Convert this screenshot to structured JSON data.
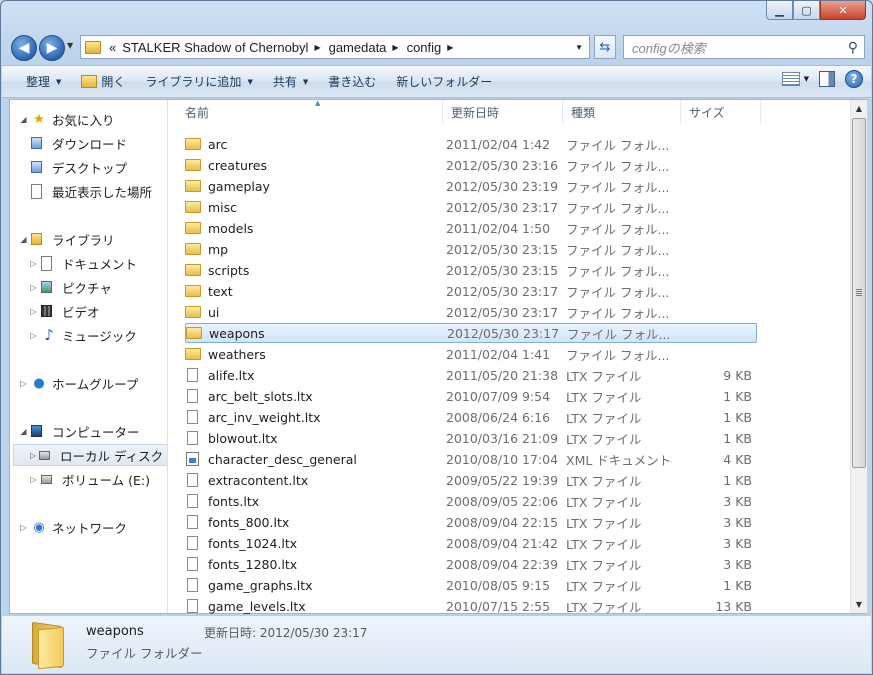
{
  "window": {
    "caption_buttons": [
      "▁",
      "▢",
      "✕"
    ]
  },
  "address_bar": {
    "overflow": "«",
    "crumbs": [
      "STALKER Shadow of Chernobyl",
      "gamedata",
      "config"
    ]
  },
  "search": {
    "placeholder": "configの検索"
  },
  "toolbar": {
    "organize": "整理",
    "open": "開く",
    "include_library": "ライブラリに追加",
    "share": "共有",
    "burn": "書き込む",
    "new_folder": "新しいフォルダー"
  },
  "navpane": {
    "favorites": "お気に入り",
    "downloads": "ダウンロード",
    "desktop": "デスクトップ",
    "recent": "最近表示した場所",
    "libraries": "ライブラリ",
    "documents": "ドキュメント",
    "pictures": "ピクチャ",
    "videos": "ビデオ",
    "music": "ミュージック",
    "homegroup": "ホームグループ",
    "computer": "コンピューター",
    "local_disk": "ローカル ディスク (",
    "volume_e": "ボリューム (E:)",
    "network": "ネットワーク"
  },
  "columns": {
    "name": "名前",
    "date": "更新日時",
    "type": "種類",
    "size": "サイズ"
  },
  "files": [
    {
      "name": "arc",
      "date": "2011/02/04 1:42",
      "type": "ファイル フォル...",
      "size": "",
      "kind": "folder"
    },
    {
      "name": "creatures",
      "date": "2012/05/30 23:16",
      "type": "ファイル フォル...",
      "size": "",
      "kind": "folder"
    },
    {
      "name": "gameplay",
      "date": "2012/05/30 23:19",
      "type": "ファイル フォル...",
      "size": "",
      "kind": "folder"
    },
    {
      "name": "misc",
      "date": "2012/05/30 23:17",
      "type": "ファイル フォル...",
      "size": "",
      "kind": "folder"
    },
    {
      "name": "models",
      "date": "2011/02/04 1:50",
      "type": "ファイル フォル...",
      "size": "",
      "kind": "folder"
    },
    {
      "name": "mp",
      "date": "2012/05/30 23:15",
      "type": "ファイル フォル...",
      "size": "",
      "kind": "folder"
    },
    {
      "name": "scripts",
      "date": "2012/05/30 23:15",
      "type": "ファイル フォル...",
      "size": "",
      "kind": "folder"
    },
    {
      "name": "text",
      "date": "2012/05/30 23:17",
      "type": "ファイル フォル...",
      "size": "",
      "kind": "folder"
    },
    {
      "name": "ui",
      "date": "2012/05/30 23:17",
      "type": "ファイル フォル...",
      "size": "",
      "kind": "folder"
    },
    {
      "name": "weapons",
      "date": "2012/05/30 23:17",
      "type": "ファイル フォル...",
      "size": "",
      "kind": "folder",
      "selected": true
    },
    {
      "name": "weathers",
      "date": "2011/02/04 1:41",
      "type": "ファイル フォル...",
      "size": "",
      "kind": "folder"
    },
    {
      "name": "alife.ltx",
      "date": "2011/05/20 21:38",
      "type": "LTX ファイル",
      "size": "9 KB",
      "kind": "file"
    },
    {
      "name": "arc_belt_slots.ltx",
      "date": "2010/07/09 9:54",
      "type": "LTX ファイル",
      "size": "1 KB",
      "kind": "file"
    },
    {
      "name": "arc_inv_weight.ltx",
      "date": "2008/06/24 6:16",
      "type": "LTX ファイル",
      "size": "1 KB",
      "kind": "file"
    },
    {
      "name": "blowout.ltx",
      "date": "2010/03/16 21:09",
      "type": "LTX ファイル",
      "size": "1 KB",
      "kind": "file"
    },
    {
      "name": "character_desc_general",
      "date": "2010/08/10 17:04",
      "type": "XML ドキュメント",
      "size": "4 KB",
      "kind": "xml"
    },
    {
      "name": "extracontent.ltx",
      "date": "2009/05/22 19:39",
      "type": "LTX ファイル",
      "size": "1 KB",
      "kind": "file"
    },
    {
      "name": "fonts.ltx",
      "date": "2008/09/05 22:06",
      "type": "LTX ファイル",
      "size": "3 KB",
      "kind": "file"
    },
    {
      "name": "fonts_800.ltx",
      "date": "2008/09/04 22:15",
      "type": "LTX ファイル",
      "size": "3 KB",
      "kind": "file"
    },
    {
      "name": "fonts_1024.ltx",
      "date": "2008/09/04 21:42",
      "type": "LTX ファイル",
      "size": "3 KB",
      "kind": "file"
    },
    {
      "name": "fonts_1280.ltx",
      "date": "2008/09/04 22:39",
      "type": "LTX ファイル",
      "size": "3 KB",
      "kind": "file"
    },
    {
      "name": "game_graphs.ltx",
      "date": "2010/08/05 9:15",
      "type": "LTX ファイル",
      "size": "1 KB",
      "kind": "file"
    },
    {
      "name": "game_levels.ltx",
      "date": "2010/07/15 2:55",
      "type": "LTX ファイル",
      "size": "13 KB",
      "kind": "file"
    }
  ],
  "details": {
    "name": "weapons",
    "type": "ファイル フォルダー",
    "modified": "更新日時: 2012/05/30 23:17"
  }
}
